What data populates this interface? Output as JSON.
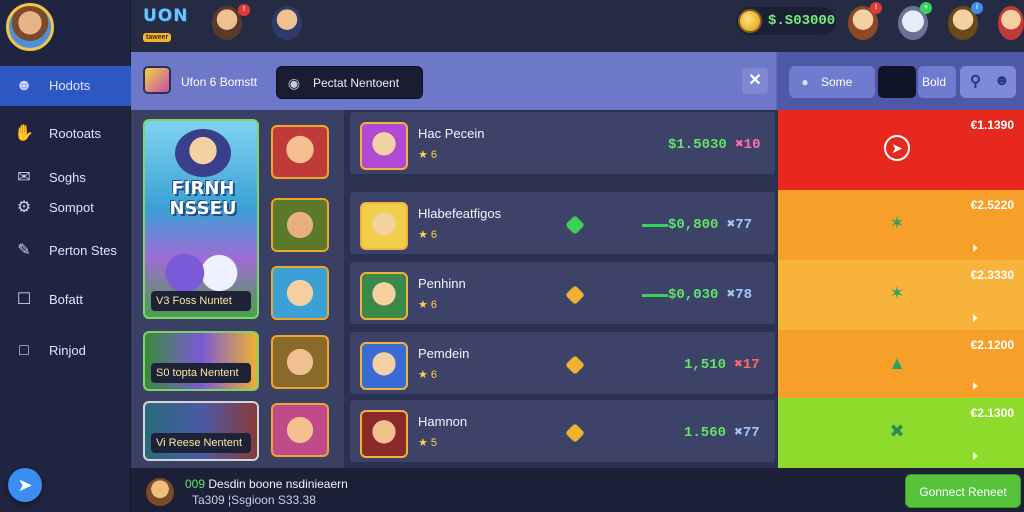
{
  "header": {
    "logo_main": "UON",
    "logo_sub": "taweer",
    "coin_balance": "$.S03000",
    "colors": {
      "accent": "#2d58c4",
      "coin": "#77ee77",
      "panel": "#6e78c9"
    }
  },
  "sidebar": {
    "items": [
      {
        "label": "Hodots",
        "icon": "profile-icon",
        "active": true
      },
      {
        "label": "Rootoats",
        "icon": "hand-icon"
      },
      {
        "label": "Soghs",
        "icon": "chat-icon"
      },
      {
        "label": "Sompot",
        "icon": "gear-icon"
      },
      {
        "label": "Perton Stes",
        "icon": "pencil-icon"
      },
      {
        "label": "Bofatt",
        "icon": "clipboard-icon"
      },
      {
        "label": "Rinjod",
        "icon": "dashed-square-icon"
      }
    ]
  },
  "toolbar": {
    "left_label": "Ufon 6 Bomstt",
    "search_text": "Pectat Nentoent",
    "seg_a_label": "Some",
    "seg_b_label": "Bold"
  },
  "catalog": {
    "featured_title": "FIRNH NSSEU",
    "featured_caption": "V3 Foss Nuntet",
    "card2_caption": "S0 topta Nentent",
    "card3_caption": "Vi Reese Nentent"
  },
  "list": {
    "rows": [
      {
        "name": "Hac Pecein",
        "stars": "★ 6",
        "amount": "1.5030",
        "mult": "✖10",
        "mult_style": "x"
      },
      {
        "name": "Hlabefeatfigos",
        "stars": "★ 6",
        "amount": "0,800",
        "mult": "✖77",
        "mult_style": "x2"
      },
      {
        "name": "Penhinn",
        "stars": "★ 6",
        "amount": "0,030",
        "mult": "✖78",
        "mult_style": "x2"
      },
      {
        "name": "Pemdein",
        "stars": "★ 6",
        "amount": "1,510",
        "mult": "✖17",
        "mult_style": "x3"
      },
      {
        "name": "Hamnon",
        "stars": "★ 5",
        "amount": "1.560",
        "mult": "✖77",
        "mult_style": "x2"
      }
    ]
  },
  "prices": [
    {
      "value": "€1.1390",
      "color": "#e6281e",
      "icon": "compass-icon"
    },
    {
      "value": "€2.5220",
      "color": "#f6a02a",
      "icon": "star-icon"
    },
    {
      "value": "€2.3330",
      "color": "#f8b43a",
      "icon": "star-icon"
    },
    {
      "value": "€2.1200",
      "color": "#f6a02a",
      "icon": "leaf-icon"
    },
    {
      "value": "€2.1300",
      "color": "#8fdb2c",
      "icon": "cross-icon"
    }
  ],
  "footer": {
    "line1_prefix": "009",
    "line1_text": " Desdin boone nsdinieaern",
    "line2": "Ta309 ¦Ssgioon S33.38",
    "connect_label": "Gonnect Reneet"
  }
}
